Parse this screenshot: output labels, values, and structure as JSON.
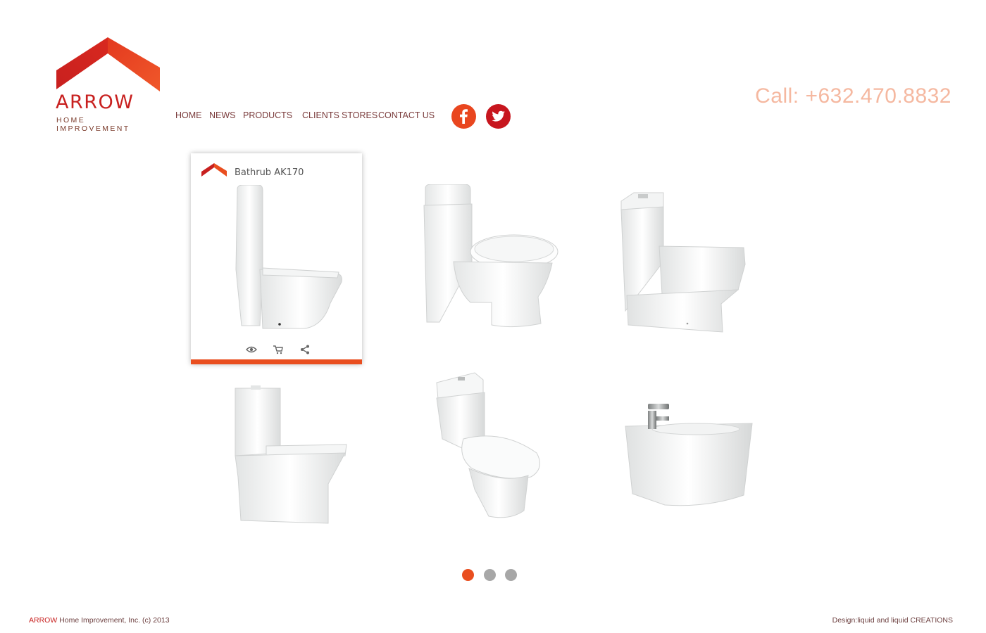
{
  "brand": {
    "name": "ARROW",
    "tagline": "HOME IMPROVEMENT",
    "colors": {
      "red": "#c8201f",
      "orange": "#e94e1f"
    }
  },
  "nav": {
    "items": [
      {
        "label": "HOME"
      },
      {
        "label": "NEWS"
      },
      {
        "label": "PRODUCTS"
      },
      {
        "label": "CLIENTS"
      },
      {
        "label": "STORES"
      },
      {
        "label": "CONTACT US"
      }
    ]
  },
  "social": [
    {
      "name": "facebook-icon"
    },
    {
      "name": "twitter-icon"
    }
  ],
  "contact": {
    "phone": "Call: +632.470.8832"
  },
  "products": {
    "featured": {
      "title": "Bathrub AK170",
      "actions": [
        "eye-icon",
        "cart-icon",
        "share-icon"
      ]
    },
    "items": [
      {
        "type": "toilet-two-piece"
      },
      {
        "type": "toilet-classic"
      },
      {
        "type": "toilet-square"
      },
      {
        "type": "toilet-square-tall"
      },
      {
        "type": "toilet-modern"
      },
      {
        "type": "bidet"
      }
    ]
  },
  "pager": {
    "pages": 3,
    "active": 1
  },
  "footer": {
    "brand": "ARROW",
    "copyright": "Home Improvement, Inc. (c) 2013",
    "credit": "Design:liquid and liquid CREATIONS"
  }
}
